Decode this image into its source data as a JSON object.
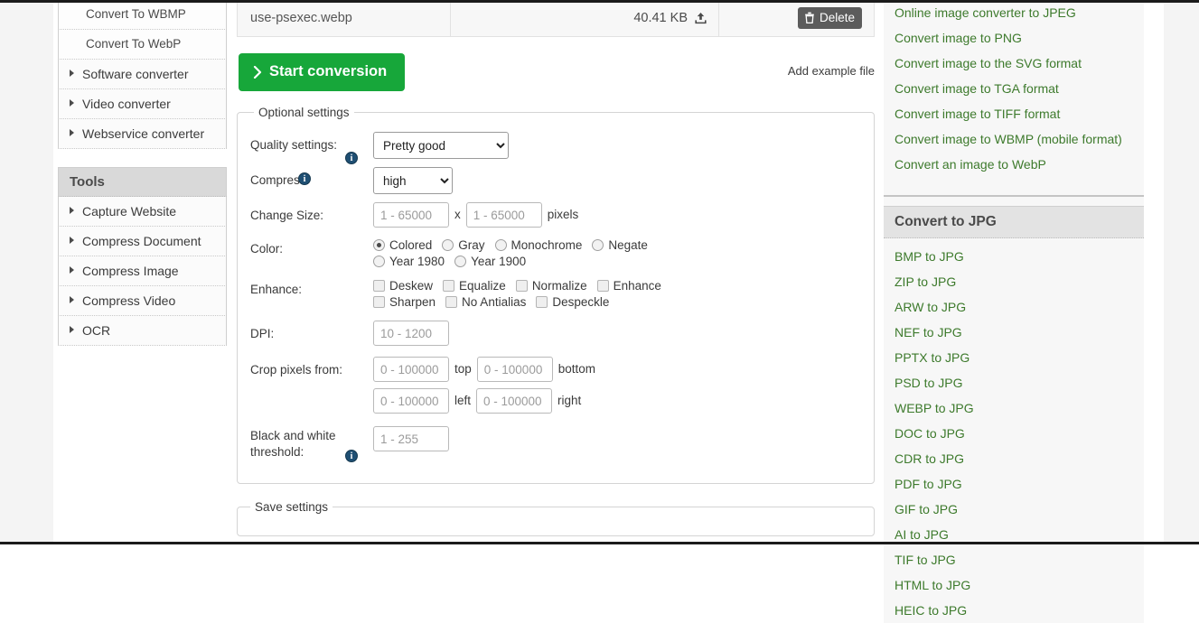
{
  "left_sidebar": {
    "converter_items": [
      {
        "label": "Convert To WBMP",
        "type": "sub"
      },
      {
        "label": "Convert To WebP",
        "type": "sub"
      },
      {
        "label": "Software converter",
        "type": "group"
      },
      {
        "label": "Video converter",
        "type": "group"
      },
      {
        "label": "Webservice converter",
        "type": "group"
      }
    ],
    "tools_header": "Tools",
    "tools_items": [
      {
        "label": "Capture Website"
      },
      {
        "label": "Compress Document"
      },
      {
        "label": "Compress Image"
      },
      {
        "label": "Compress Video"
      },
      {
        "label": "OCR"
      }
    ]
  },
  "file_row": {
    "name": "use-psexec.webp",
    "size": "40.41 KB",
    "upload_icon": "upload-icon",
    "delete_label": "Delete",
    "delete_icon": "trash-icon",
    "delete_bg": "#5c5c5c"
  },
  "actions": {
    "start_label": "Start conversion",
    "start_icon": "chevron-right-icon",
    "start_bg": "#17a73a",
    "add_example_label": "Add example file"
  },
  "optional_settings": {
    "legend": "Optional settings",
    "quality": {
      "label": "Quality settings:",
      "info_icon": "info-icon",
      "value": "Pretty good",
      "options": [
        "Pretty good"
      ]
    },
    "compress": {
      "label": "Compress:",
      "info_icon": "info-icon",
      "value": "high",
      "options": [
        "high"
      ]
    },
    "change_size": {
      "label": "Change Size:",
      "width_placeholder": "1 - 65000",
      "height_placeholder": "1 - 65000",
      "separator": "x",
      "unit": "pixels"
    },
    "color": {
      "label": "Color:",
      "options": [
        {
          "label": "Colored",
          "checked": true
        },
        {
          "label": "Gray",
          "checked": false
        },
        {
          "label": "Monochrome",
          "checked": false
        },
        {
          "label": "Negate",
          "checked": false
        },
        {
          "label": "Year 1980",
          "checked": false
        },
        {
          "label": "Year 1900",
          "checked": false
        }
      ]
    },
    "enhance": {
      "label": "Enhance:",
      "options": [
        {
          "label": "Deskew",
          "checked": false
        },
        {
          "label": "Equalize",
          "checked": false
        },
        {
          "label": "Normalize",
          "checked": false
        },
        {
          "label": "Enhance",
          "checked": false
        },
        {
          "label": "Sharpen",
          "checked": false
        },
        {
          "label": "No Antialias",
          "checked": false
        },
        {
          "label": "Despeckle",
          "checked": false
        }
      ]
    },
    "dpi": {
      "label": "DPI:",
      "placeholder": "10 - 1200"
    },
    "crop": {
      "label": "Crop pixels from:",
      "fields": [
        {
          "placeholder": "0 - 100000",
          "unit": "top"
        },
        {
          "placeholder": "0 - 100000",
          "unit": "bottom"
        },
        {
          "placeholder": "0 - 100000",
          "unit": "left"
        },
        {
          "placeholder": "0 - 100000",
          "unit": "right"
        }
      ]
    },
    "bw_threshold": {
      "label_line1": "Black and white",
      "label_line2": "threshold:",
      "info_icon": "info-icon",
      "placeholder": "1 - 255"
    }
  },
  "save_settings": {
    "legend": "Save settings"
  },
  "right_rail": {
    "top_links": [
      "Online image converter to JPEG",
      "Convert image to PNG",
      "Convert image to the SVG format",
      "Convert image to TGA format",
      "Convert image to TIFF format",
      "Convert image to WBMP (mobile format)",
      "Convert an image to WebP"
    ],
    "section_header": "Convert to JPG",
    "section_links": [
      "BMP to JPG",
      "ZIP to JPG",
      "ARW to JPG",
      "NEF to JPG",
      "PPTX to JPG",
      "PSD to JPG",
      "WEBP to JPG",
      "DOC to JPG",
      "CDR to JPG",
      "PDF to JPG",
      "GIF to JPG",
      "AI to JPG",
      "TIF to JPG",
      "HTML to JPG",
      "HEIC to JPG"
    ],
    "link_color": "#3d7a2c"
  }
}
